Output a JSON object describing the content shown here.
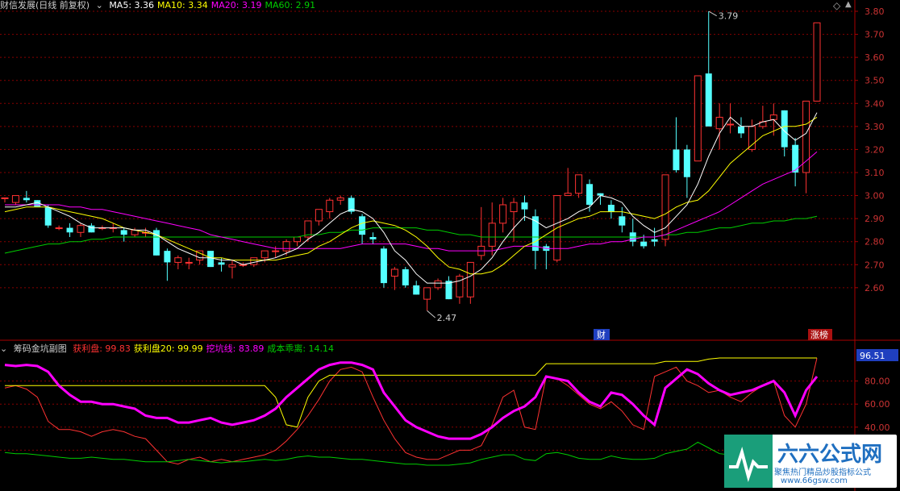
{
  "colors": {
    "bg": "#000000",
    "up": "#ff3232",
    "down": "#54ffff",
    "ma5": "#ffffff",
    "ma10": "#ffff00",
    "ma20": "#ff00ff",
    "ma60": "#00cc00",
    "grid": "#880000",
    "axis_text": "#cc3333",
    "profit": "#ff3232",
    "profit20": "#ffff00",
    "dig": "#ff00ff",
    "cost": "#00cc00"
  },
  "top_header": {
    "title": "财信发展(日线 前复权)",
    "items": [
      {
        "label": "MA5:",
        "value": "3.36",
        "color": "#ffffff"
      },
      {
        "label": "MA10:",
        "value": "3.34",
        "color": "#ffff00"
      },
      {
        "label": "MA20:",
        "value": "3.19",
        "color": "#ff00ff"
      },
      {
        "label": "MA60:",
        "value": "2.91",
        "color": "#00cc00"
      }
    ]
  },
  "bottom_header": {
    "title": "筹码金坑副图",
    "items": [
      {
        "label": "获利盘:",
        "value": "99.83",
        "color": "#ff3232"
      },
      {
        "label": "获利盘20:",
        "value": "99.99",
        "color": "#ffff00"
      },
      {
        "label": "挖坑线:",
        "value": "83.89",
        "color": "#ff00ff"
      },
      {
        "label": "成本乖离:",
        "value": "14.14",
        "color": "#00cc00"
      }
    ]
  },
  "annotations": {
    "high_label": "3.79",
    "low_label": "2.47",
    "tag_cai": "财",
    "tag_zhangbang": "涨榜",
    "current_value": "96.51"
  },
  "chart_data": [
    {
      "type": "candlestick",
      "title": "财信发展(日线 前复权)",
      "ylim": [
        2.5,
        3.85
      ],
      "y_ticks": [
        "3.80",
        "3.70",
        "3.60",
        "3.50",
        "3.40",
        "3.30",
        "3.20",
        "3.10",
        "3.00",
        "2.90",
        "2.80",
        "2.70",
        "2.60"
      ],
      "candles": [
        [
          2.99,
          2.99,
          2.97,
          2.99
        ],
        [
          2.97,
          3.0,
          2.96,
          3.0
        ],
        [
          2.99,
          3.02,
          2.97,
          2.98
        ],
        [
          2.98,
          2.98,
          2.95,
          2.95
        ],
        [
          2.95,
          2.96,
          2.86,
          2.87
        ],
        [
          2.86,
          2.87,
          2.85,
          2.86
        ],
        [
          2.86,
          2.88,
          2.82,
          2.84
        ],
        [
          2.84,
          2.88,
          2.82,
          2.87
        ],
        [
          2.87,
          2.88,
          2.84,
          2.84
        ],
        [
          2.86,
          2.87,
          2.85,
          2.86
        ],
        [
          2.86,
          2.88,
          2.84,
          2.86
        ],
        [
          2.85,
          2.86,
          2.8,
          2.83
        ],
        [
          2.83,
          2.86,
          2.82,
          2.85
        ],
        [
          2.84,
          2.86,
          2.82,
          2.84
        ],
        [
          2.85,
          2.86,
          2.74,
          2.74
        ],
        [
          2.76,
          2.77,
          2.63,
          2.71
        ],
        [
          2.71,
          2.74,
          2.68,
          2.73
        ],
        [
          2.71,
          2.73,
          2.68,
          2.71
        ],
        [
          2.72,
          2.76,
          2.7,
          2.76
        ],
        [
          2.76,
          2.76,
          2.69,
          2.69
        ],
        [
          2.71,
          2.73,
          2.67,
          2.7
        ],
        [
          2.69,
          2.72,
          2.64,
          2.7
        ],
        [
          2.7,
          2.71,
          2.69,
          2.7
        ],
        [
          2.7,
          2.73,
          2.69,
          2.73
        ],
        [
          2.73,
          2.76,
          2.71,
          2.76
        ],
        [
          2.76,
          2.78,
          2.73,
          2.76
        ],
        [
          2.76,
          2.81,
          2.74,
          2.8
        ],
        [
          2.8,
          2.82,
          2.78,
          2.82
        ],
        [
          2.82,
          2.89,
          2.8,
          2.89
        ],
        [
          2.89,
          2.94,
          2.87,
          2.94
        ],
        [
          2.93,
          2.99,
          2.9,
          2.98
        ],
        [
          2.98,
          3.0,
          2.96,
          2.99
        ],
        [
          2.99,
          3.0,
          2.92,
          2.93
        ],
        [
          2.91,
          2.92,
          2.79,
          2.83
        ],
        [
          2.82,
          2.84,
          2.79,
          2.81
        ],
        [
          2.77,
          2.78,
          2.6,
          2.62
        ],
        [
          2.65,
          2.69,
          2.59,
          2.68
        ],
        [
          2.68,
          2.69,
          2.6,
          2.61
        ],
        [
          2.61,
          2.63,
          2.57,
          2.57
        ],
        [
          2.55,
          2.6,
          2.5,
          2.6
        ],
        [
          2.6,
          2.64,
          2.59,
          2.63
        ],
        [
          2.63,
          2.65,
          2.55,
          2.55
        ],
        [
          2.56,
          2.66,
          2.53,
          2.65
        ],
        [
          2.56,
          2.71,
          2.53,
          2.71
        ],
        [
          2.74,
          2.95,
          2.72,
          2.78
        ],
        [
          2.78,
          2.97,
          2.74,
          2.88
        ],
        [
          2.88,
          2.99,
          2.84,
          2.96
        ],
        [
          2.93,
          2.99,
          2.8,
          2.97
        ],
        [
          2.97,
          3.0,
          2.89,
          2.94
        ],
        [
          2.91,
          2.94,
          2.68,
          2.76
        ],
        [
          2.78,
          2.79,
          2.68,
          2.76
        ],
        [
          2.72,
          3.0,
          2.71,
          3.0
        ],
        [
          3.0,
          3.12,
          3.0,
          3.01
        ],
        [
          3.01,
          3.09,
          2.99,
          3.09
        ],
        [
          3.05,
          3.07,
          2.93,
          2.96
        ],
        [
          3.01,
          3.01,
          2.96,
          3.0
        ],
        [
          2.96,
          2.98,
          2.9,
          2.93
        ],
        [
          2.91,
          2.95,
          2.84,
          2.87
        ],
        [
          2.84,
          2.9,
          2.78,
          2.8
        ],
        [
          2.8,
          2.83,
          2.77,
          2.78
        ],
        [
          2.81,
          2.86,
          2.78,
          2.8
        ],
        [
          2.81,
          3.09,
          2.78,
          3.09
        ],
        [
          3.2,
          3.34,
          3.1,
          3.11
        ],
        [
          3.2,
          3.22,
          2.99,
          3.08
        ],
        [
          3.15,
          3.52,
          3.15,
          3.52
        ],
        [
          3.53,
          3.8,
          3.31,
          3.3
        ],
        [
          3.29,
          3.4,
          3.2,
          3.34
        ],
        [
          3.31,
          3.4,
          3.27,
          3.31
        ],
        [
          3.3,
          3.34,
          3.25,
          3.27
        ],
        [
          3.2,
          3.33,
          3.19,
          3.3
        ],
        [
          3.3,
          3.39,
          3.29,
          3.32
        ],
        [
          3.33,
          3.4,
          3.26,
          3.35
        ],
        [
          3.37,
          3.37,
          3.17,
          3.21
        ],
        [
          3.22,
          3.25,
          3.04,
          3.1
        ],
        [
          3.1,
          3.4,
          3.01,
          3.41
        ],
        [
          3.41,
          3.75,
          3.41,
          3.75
        ]
      ],
      "ma5": [
        2.95,
        2.95,
        2.96,
        2.97,
        2.95,
        2.93,
        2.91,
        2.88,
        2.86,
        2.86,
        2.86,
        2.86,
        2.85,
        2.85,
        2.83,
        2.8,
        2.77,
        2.75,
        2.73,
        2.73,
        2.72,
        2.72,
        2.7,
        2.71,
        2.72,
        2.73,
        2.75,
        2.77,
        2.81,
        2.84,
        2.88,
        2.92,
        2.94,
        2.93,
        2.9,
        2.84,
        2.76,
        2.72,
        2.66,
        2.62,
        2.62,
        2.62,
        2.63,
        2.65,
        2.68,
        2.73,
        2.8,
        2.86,
        2.91,
        2.89,
        2.86,
        2.88,
        2.9,
        2.93,
        2.95,
        3.0,
        2.99,
        2.97,
        2.91,
        2.87,
        2.84,
        2.86,
        2.91,
        2.96,
        3.05,
        3.17,
        3.27,
        3.34,
        3.3,
        3.3,
        3.32,
        3.33,
        3.28,
        3.24,
        3.27,
        3.36
      ],
      "ma10": [
        2.93,
        2.94,
        2.95,
        2.95,
        2.95,
        2.94,
        2.93,
        2.92,
        2.91,
        2.9,
        2.88,
        2.86,
        2.85,
        2.84,
        2.83,
        2.81,
        2.79,
        2.77,
        2.75,
        2.73,
        2.73,
        2.72,
        2.72,
        2.72,
        2.72,
        2.72,
        2.73,
        2.74,
        2.75,
        2.78,
        2.8,
        2.83,
        2.86,
        2.88,
        2.89,
        2.88,
        2.87,
        2.85,
        2.82,
        2.78,
        2.73,
        2.69,
        2.68,
        2.66,
        2.66,
        2.67,
        2.7,
        2.74,
        2.78,
        2.8,
        2.83,
        2.86,
        2.88,
        2.9,
        2.91,
        2.93,
        2.93,
        2.93,
        2.92,
        2.91,
        2.9,
        2.92,
        2.95,
        2.97,
        2.98,
        3.02,
        3.08,
        3.14,
        3.18,
        3.22,
        3.26,
        3.28,
        3.3,
        3.3,
        3.31,
        3.34
      ],
      "ma20": [
        2.96,
        2.96,
        2.96,
        2.96,
        2.96,
        2.96,
        2.95,
        2.95,
        2.94,
        2.94,
        2.93,
        2.92,
        2.91,
        2.9,
        2.89,
        2.88,
        2.87,
        2.86,
        2.85,
        2.83,
        2.82,
        2.81,
        2.8,
        2.79,
        2.78,
        2.77,
        2.77,
        2.77,
        2.77,
        2.77,
        2.77,
        2.77,
        2.78,
        2.79,
        2.79,
        2.79,
        2.79,
        2.79,
        2.78,
        2.77,
        2.77,
        2.76,
        2.76,
        2.76,
        2.76,
        2.76,
        2.77,
        2.78,
        2.78,
        2.78,
        2.77,
        2.77,
        2.77,
        2.78,
        2.79,
        2.79,
        2.8,
        2.8,
        2.81,
        2.82,
        2.82,
        2.83,
        2.85,
        2.87,
        2.89,
        2.91,
        2.93,
        2.96,
        2.99,
        3.02,
        3.05,
        3.07,
        3.09,
        3.11,
        3.15,
        3.19
      ],
      "ma60": [
        2.75,
        2.76,
        2.77,
        2.78,
        2.79,
        2.79,
        2.8,
        2.8,
        2.81,
        2.81,
        2.82,
        2.82,
        2.82,
        2.82,
        2.82,
        2.82,
        2.82,
        2.82,
        2.82,
        2.82,
        2.82,
        2.82,
        2.82,
        2.82,
        2.82,
        2.82,
        2.82,
        2.82,
        2.83,
        2.83,
        2.84,
        2.84,
        2.85,
        2.85,
        2.86,
        2.86,
        2.86,
        2.86,
        2.86,
        2.85,
        2.85,
        2.84,
        2.83,
        2.83,
        2.82,
        2.82,
        2.82,
        2.82,
        2.82,
        2.82,
        2.82,
        2.82,
        2.82,
        2.82,
        2.82,
        2.82,
        2.82,
        2.82,
        2.82,
        2.82,
        2.82,
        2.83,
        2.83,
        2.84,
        2.84,
        2.85,
        2.86,
        2.86,
        2.87,
        2.88,
        2.88,
        2.89,
        2.89,
        2.9,
        2.9,
        2.91
      ]
    },
    {
      "type": "line",
      "title": "筹码金坑副图",
      "ylim": [
        0,
        105
      ],
      "y_ticks": [
        "80.00",
        "60.00",
        "40.00",
        "20.00"
      ],
      "series": [
        {
          "name": "获利盘",
          "color": "#ff3232",
          "values": [
            74,
            76,
            73,
            66,
            45,
            38,
            38,
            36,
            32,
            36,
            38,
            36,
            32,
            30,
            20,
            10,
            8,
            12,
            14,
            10,
            12,
            10,
            12,
            14,
            16,
            20,
            28,
            38,
            50,
            64,
            80,
            90,
            92,
            88,
            66,
            46,
            30,
            18,
            14,
            12,
            12,
            16,
            20,
            20,
            24,
            42,
            66,
            72,
            40,
            38,
            84,
            82,
            76,
            68,
            60,
            56,
            62,
            54,
            42,
            38,
            84,
            88,
            92,
            80,
            76,
            70,
            72,
            66,
            62,
            70,
            76,
            80,
            50,
            40,
            60,
            99.83
          ]
        },
        {
          "name": "获利盘20",
          "color": "#ffff00",
          "values": [
            76,
            76,
            76,
            76,
            76,
            76,
            76,
            76,
            76,
            76,
            76,
            76,
            76,
            76,
            76,
            76,
            76,
            76,
            76,
            76,
            76,
            76,
            76,
            76,
            76,
            66,
            42,
            40,
            66,
            80,
            85,
            85,
            85,
            85,
            85,
            85,
            85,
            85,
            85,
            85,
            85,
            85,
            85,
            85,
            85,
            85,
            85,
            85,
            85,
            85,
            95,
            95,
            95,
            95,
            95,
            95,
            95,
            95,
            95,
            95,
            95,
            97,
            97,
            97,
            97,
            99,
            99.99,
            99.99,
            99.99,
            99.99,
            99.99,
            99.99,
            99.99,
            99.99,
            99.99,
            99.99
          ]
        },
        {
          "name": "挖坑线",
          "color": "#ff00ff",
          "values": [
            94,
            93,
            94,
            93,
            88,
            76,
            68,
            62,
            62,
            60,
            60,
            58,
            56,
            50,
            48,
            48,
            44,
            44,
            46,
            48,
            44,
            42,
            44,
            46,
            50,
            56,
            66,
            74,
            82,
            90,
            94,
            96,
            96,
            94,
            90,
            70,
            58,
            46,
            40,
            36,
            32,
            30,
            30,
            30,
            34,
            40,
            48,
            54,
            58,
            66,
            84,
            82,
            80,
            70,
            62,
            58,
            70,
            68,
            60,
            50,
            42,
            74,
            82,
            90,
            86,
            78,
            72,
            68,
            70,
            72,
            76,
            80,
            70,
            50,
            72,
            83.89
          ]
        },
        {
          "name": "成本乖离",
          "color": "#00cc00",
          "values": [
            18,
            17,
            17,
            16,
            15,
            14,
            13,
            13,
            14,
            13,
            12,
            12,
            11,
            10,
            10,
            10,
            11,
            12,
            11,
            10,
            9,
            10,
            10,
            11,
            12,
            11,
            12,
            14,
            15,
            14,
            14,
            13,
            12,
            12,
            11,
            10,
            9,
            8,
            8,
            7,
            7,
            7,
            8,
            9,
            12,
            14,
            16,
            16,
            12,
            11,
            17,
            18,
            16,
            13,
            12,
            12,
            15,
            13,
            12,
            12,
            13,
            17,
            19,
            21,
            27,
            22,
            17,
            16,
            15,
            13,
            12,
            12,
            11,
            9,
            10,
            14.14
          ]
        }
      ]
    }
  ]
}
